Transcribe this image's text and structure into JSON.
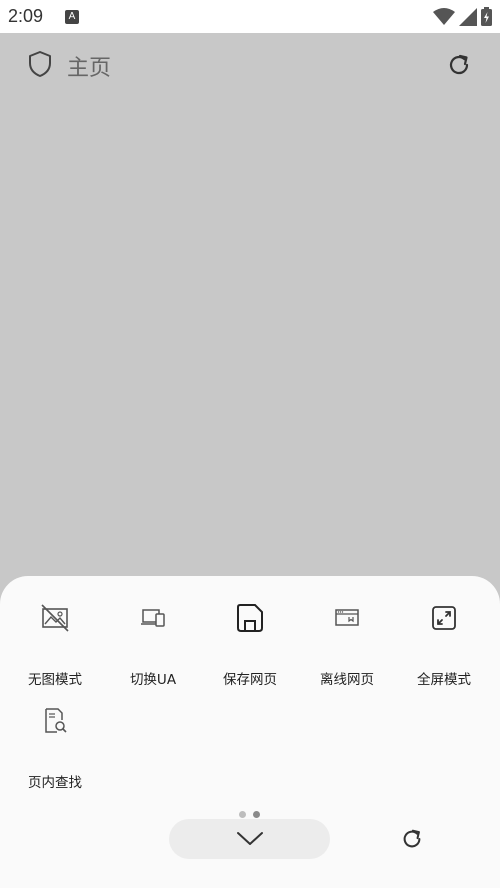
{
  "status_bar": {
    "time": "2:09",
    "app_icon_letter": "A"
  },
  "header": {
    "title": "主页",
    "shield_icon": "shield-icon",
    "reload_icon": "reload-icon"
  },
  "menu": {
    "items": [
      {
        "label": "无图模式",
        "icon": "no-image-icon"
      },
      {
        "label": "切换UA",
        "icon": "devices-icon"
      },
      {
        "label": "保存网页",
        "icon": "save-icon"
      },
      {
        "label": "离线网页",
        "icon": "offline-page-icon"
      },
      {
        "label": "全屏模式",
        "icon": "fullscreen-icon"
      },
      {
        "label": "页内查找",
        "icon": "find-in-page-icon"
      }
    ],
    "page_count": 2,
    "active_page": 2
  },
  "colors": {
    "page_bg": "#c8c8c8",
    "sheet_bg": "#fafafa",
    "text": "#222222"
  }
}
